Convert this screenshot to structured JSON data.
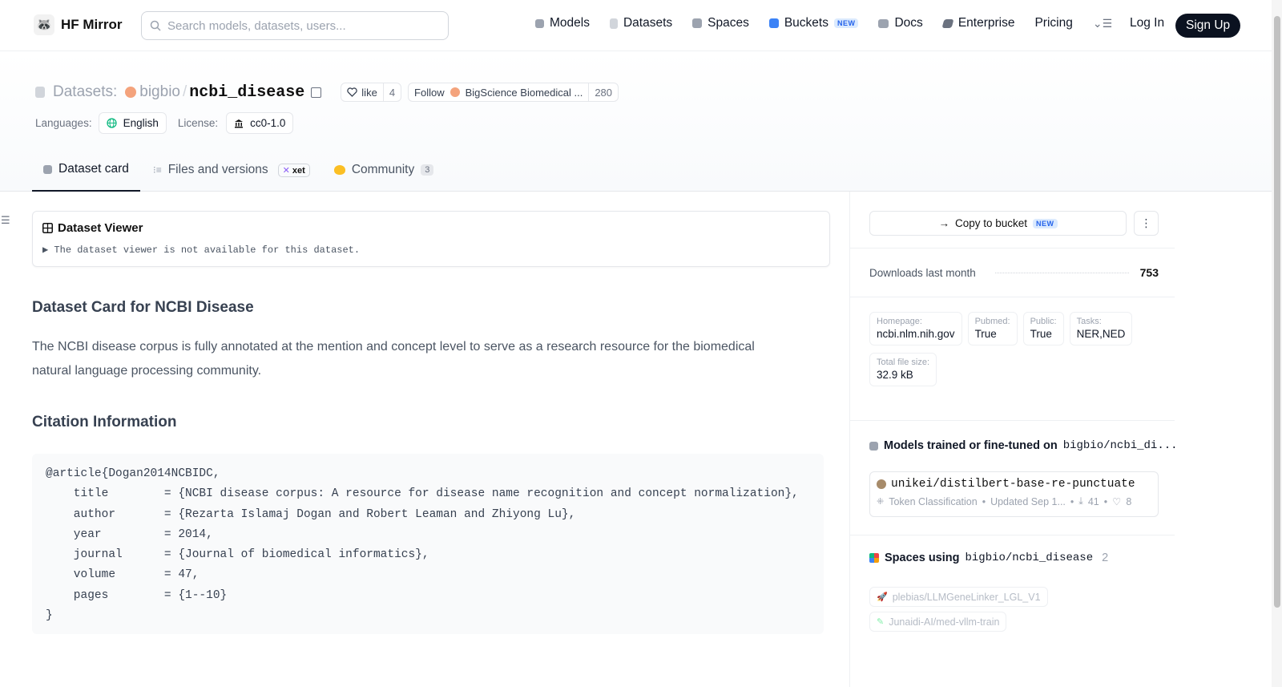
{
  "nav": {
    "brand": "HF Mirror",
    "search_placeholder": "Search models, datasets, users...",
    "items": [
      {
        "label": "Models",
        "icon": "cube-icon",
        "color": "#9ca3af"
      },
      {
        "label": "Datasets",
        "icon": "database-icon",
        "color": "#d1d5db"
      },
      {
        "label": "Spaces",
        "icon": "grid-icon",
        "color": "#9ca3af"
      },
      {
        "label": "Buckets",
        "icon": "bucket-icon",
        "color": "#3b82f6",
        "badge": "NEW"
      },
      {
        "label": "Docs",
        "icon": "book-icon",
        "color": "#9ca3af"
      },
      {
        "label": "Enterprise",
        "icon": "enterprise-icon",
        "color": "#6b7280"
      },
      {
        "label": "Pricing",
        "icon": "",
        "color": ""
      }
    ],
    "login": "Log In",
    "signup": "Sign Up"
  },
  "header": {
    "section": "Datasets:",
    "org": "bigbio",
    "slash": "/",
    "repo": "ncbi_disease",
    "like_label": "like",
    "like_count": "4",
    "follow_label": "Follow",
    "follow_org": "BigScience Biomedical ...",
    "follow_count": "280",
    "languages_label": "Languages:",
    "language": "English",
    "license_label": "License:",
    "license": "cc0-1.0"
  },
  "tabs": [
    {
      "label": "Dataset card",
      "active": true
    },
    {
      "label": "Files and versions",
      "badge": "xet"
    },
    {
      "label": "Community",
      "count": "3"
    }
  ],
  "main": {
    "viewer_title": "Dataset Viewer",
    "viewer_msg": "▶ The dataset viewer is not available for this dataset.",
    "card_title": "Dataset Card for NCBI Disease",
    "description": "The NCBI disease corpus is fully annotated at the mention and concept level to serve as a research resource for the biomedical natural language processing community.",
    "citation_title": "Citation Information",
    "citation": "@article{Dogan2014NCBIDC,\n    title        = {NCBI disease corpus: A resource for disease name recognition and concept normalization},\n    author       = {Rezarta Islamaj Dogan and Robert Leaman and Zhiyong Lu},\n    year         = 2014,\n    journal      = {Journal of biomedical informatics},\n    volume       = 47,\n    pages        = {1--10}\n}"
  },
  "sidebar": {
    "copy_bucket": "Copy to bucket",
    "copy_badge": "NEW",
    "downloads_label": "Downloads last month",
    "downloads_value": "753",
    "info": [
      {
        "key": "Homepage:",
        "value": "ncbi.nlm.nih.gov"
      },
      {
        "key": "Pubmed:",
        "value": "True"
      },
      {
        "key": "Public:",
        "value": "True"
      },
      {
        "key": "Tasks:",
        "value": "NER,NED"
      },
      {
        "key": "Total file size:",
        "value": "32.9 kB"
      }
    ],
    "models_title": "Models trained or fine-tuned on",
    "models_repo": "bigbio/ncbi_di...",
    "model": {
      "name": "unikei/distilbert-base-re-punctuate",
      "task": "Token Classification",
      "updated": "Updated Sep 1...",
      "downloads": "41",
      "likes": "8"
    },
    "spaces_title": "Spaces using",
    "spaces_repo": "bigbio/ncbi_disease",
    "spaces_count": "2",
    "spaces": [
      {
        "name": "plebias/LLMGeneLinker_LGL_V1",
        "icon": "rocket-icon"
      },
      {
        "name": "Junaidi-AI/med-vllm-train",
        "icon": "pencil-icon"
      }
    ]
  }
}
